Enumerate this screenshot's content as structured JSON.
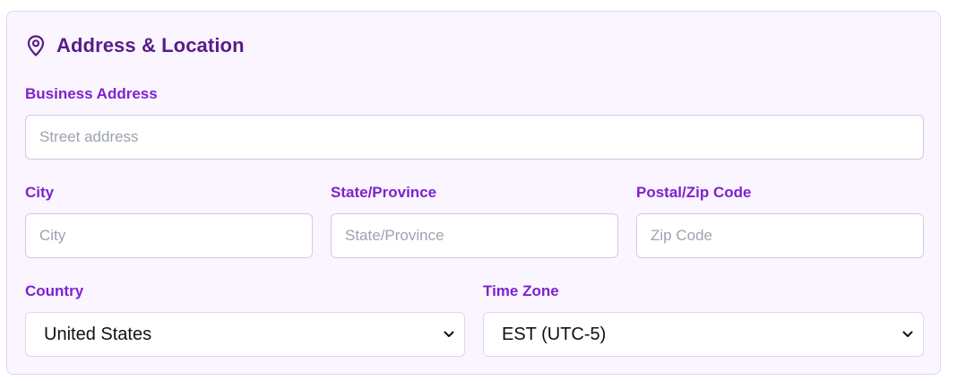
{
  "section": {
    "title": "Address & Location",
    "icon": "map-pin-icon"
  },
  "fields": {
    "business_address": {
      "label": "Business Address",
      "value": "",
      "placeholder": "Street address"
    },
    "city": {
      "label": "City",
      "value": "",
      "placeholder": "City"
    },
    "state": {
      "label": "State/Province",
      "value": "",
      "placeholder": "State/Province"
    },
    "zip": {
      "label": "Postal/Zip Code",
      "value": "",
      "placeholder": "Zip Code"
    },
    "country": {
      "label": "Country",
      "selected": "United States",
      "icon": "chevron-down-icon"
    },
    "timezone": {
      "label": "Time Zone",
      "selected": "EST (UTC-5)",
      "icon": "chevron-down-icon"
    }
  },
  "colors": {
    "card_background": "#faf5ff",
    "title": "#581c87",
    "label": "#7e22ce",
    "border": "#d8c7e6",
    "placeholder": "#9ca3af"
  }
}
